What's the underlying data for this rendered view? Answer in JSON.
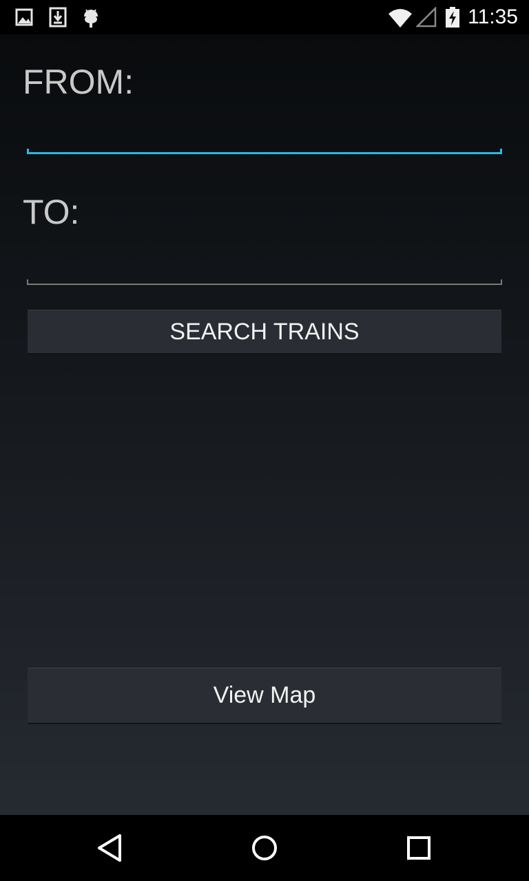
{
  "status_bar": {
    "time": "11:35",
    "left_icons": [
      "image-icon",
      "download-icon",
      "android-debug-icon"
    ],
    "right_icons": [
      "wifi-icon",
      "cellular-signal-icon",
      "battery-charging-icon"
    ]
  },
  "form": {
    "from_label": "FROM:",
    "from_value": "",
    "to_label": "TO:",
    "to_value": "",
    "accent_color": "#33b5e5",
    "inactive_line_color": "#7a7a7a"
  },
  "search_button": {
    "label": "SEARCH TRAINS"
  },
  "map_button": {
    "label": "View Map"
  },
  "nav_bar": {
    "buttons": [
      "back-icon",
      "home-icon",
      "recents-icon"
    ]
  }
}
